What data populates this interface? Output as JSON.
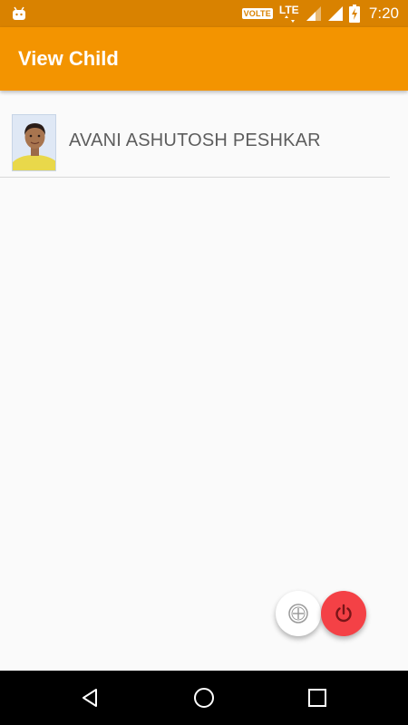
{
  "status_bar": {
    "volte_label": "VOLTE",
    "network_label": "LTE",
    "time": "7:20",
    "icons": [
      "android-icon",
      "volte-icon",
      "lte-signal-icon",
      "signal-icon",
      "battery-charging-icon"
    ]
  },
  "app_bar": {
    "title": "View Child",
    "color": "#f39400"
  },
  "children": [
    {
      "name": "AVANI ASHUTOSH PESHKAR",
      "photo_icon": "child-photo"
    }
  ],
  "fabs": {
    "add_icon": "add-circle-icon",
    "power_icon": "power-icon",
    "power_color": "#f44146"
  },
  "nav_bar": {
    "icons": [
      "back-icon",
      "home-icon",
      "recent-apps-icon"
    ]
  }
}
